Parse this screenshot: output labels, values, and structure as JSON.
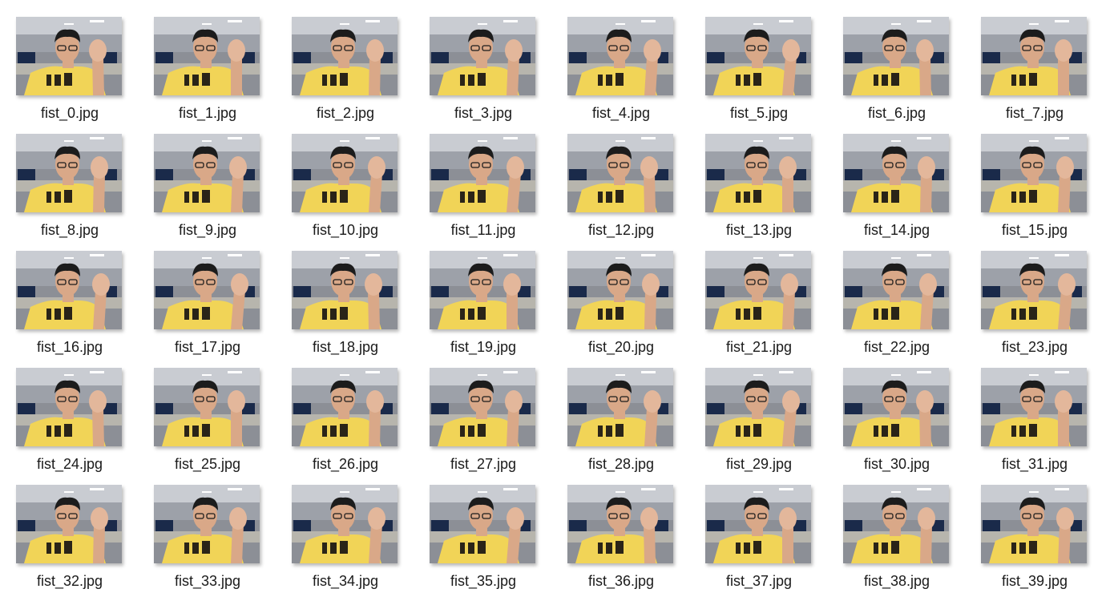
{
  "folder_view": {
    "files": [
      "fist_0.jpg",
      "fist_1.jpg",
      "fist_2.jpg",
      "fist_3.jpg",
      "fist_4.jpg",
      "fist_5.jpg",
      "fist_6.jpg",
      "fist_7.jpg",
      "fist_8.jpg",
      "fist_9.jpg",
      "fist_10.jpg",
      "fist_11.jpg",
      "fist_12.jpg",
      "fist_13.jpg",
      "fist_14.jpg",
      "fist_15.jpg",
      "fist_16.jpg",
      "fist_17.jpg",
      "fist_18.jpg",
      "fist_19.jpg",
      "fist_20.jpg",
      "fist_21.jpg",
      "fist_22.jpg",
      "fist_23.jpg",
      "fist_24.jpg",
      "fist_25.jpg",
      "fist_26.jpg",
      "fist_27.jpg",
      "fist_28.jpg",
      "fist_29.jpg",
      "fist_30.jpg",
      "fist_31.jpg",
      "fist_32.jpg",
      "fist_33.jpg",
      "fist_34.jpg",
      "fist_35.jpg",
      "fist_36.jpg",
      "fist_37.jpg",
      "fist_38.jpg",
      "fist_39.jpg"
    ],
    "thumbnail_icon": "photo-thumbnail-icon",
    "colors": {
      "shirt": "#f1d457",
      "skin": "#d9a888",
      "office_bg": "#8c8f96",
      "monitor": "#1a2a4a",
      "label_text": "#1a1a1a"
    }
  }
}
